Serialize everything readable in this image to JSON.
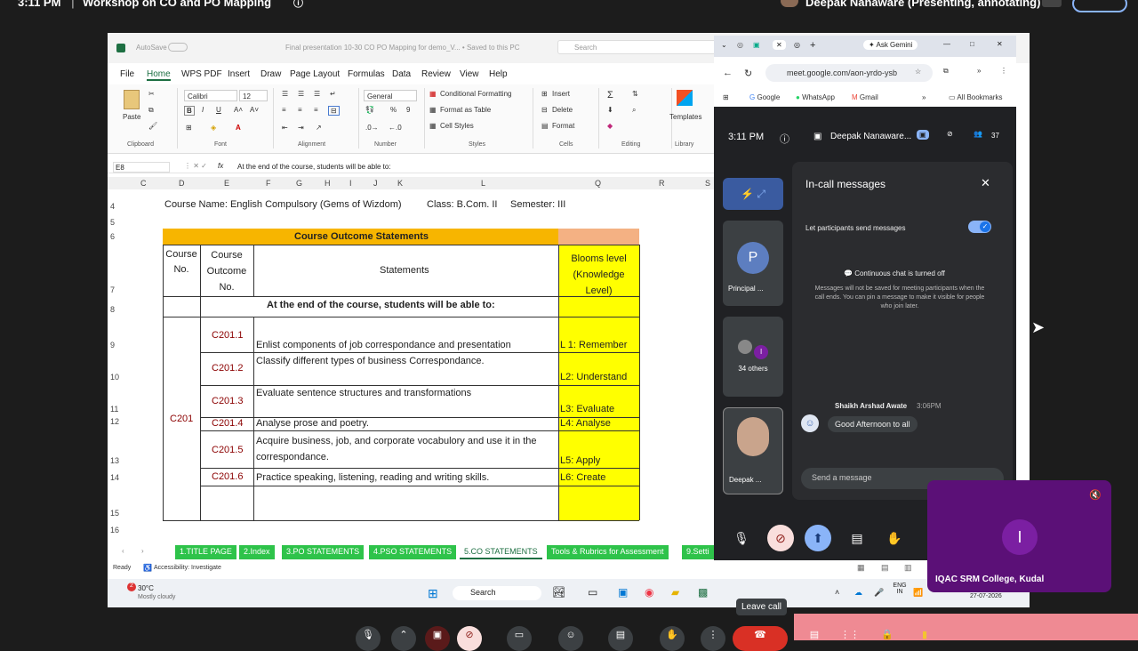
{
  "meet_top": {
    "time": "3:11 PM",
    "meeting_title": "Workshop on CO and PO Mapping",
    "presenter": "Deepak Nanaware (Presenting, annotating)"
  },
  "excel": {
    "autosave": "AutoSave",
    "file_title": "Final presentation 10-30 CO PO Mapping for demo_V... • Saved to this PC",
    "search": "Search",
    "menu": [
      "File",
      "Home",
      "WPS PDF",
      "Insert",
      "Draw",
      "Page Layout",
      "Formulas",
      "Data",
      "Review",
      "View",
      "Help"
    ],
    "ribbon": {
      "paste": "Paste",
      "font_name": "Calibri",
      "font_size": "12",
      "number_format": "General",
      "conditional": "Conditional Formatting",
      "format_table": "Format as Table",
      "cell_styles": "Cell Styles",
      "insert": "Insert",
      "delete": "Delete",
      "format": "Format",
      "templates": "Templates",
      "groups": [
        "Clipboard",
        "Font",
        "Alignment",
        "Number",
        "Styles",
        "Cells",
        "Editing",
        "Library"
      ]
    },
    "name_box": "E8",
    "formula": "At the end of the course, students will be able to:",
    "columns": [
      "C",
      "D",
      "E",
      "F",
      "G",
      "H",
      "I",
      "J",
      "K",
      "L",
      "Q",
      "R",
      "S"
    ],
    "rows": [
      "4",
      "5",
      "6",
      "7",
      "8",
      "9",
      "10",
      "11",
      "12",
      "13",
      "14",
      "15",
      "16"
    ],
    "course_name": "Course Name: English Compulsory (Gems of Wizdom)",
    "class": "Class: B.Com. II",
    "semester": "Semester: III",
    "table_title": "Course Outcome Statements",
    "hdr_course_no": "Course No.",
    "hdr_outcome_no": "Course Outcome No.",
    "hdr_statements": "Statements",
    "hdr_blooms": "Blooms level (Knowledge Level)",
    "intro": "At the end of the course, students will be able to:",
    "course_code": "C201",
    "outcomes": [
      {
        "code": "C201.1",
        "text": "Enlist components of  job correspondance and presentation",
        "level": "L 1: Remember"
      },
      {
        "code": "C201.2",
        "text": "Classify different types of business Correspondance.",
        "level": "L2: Understand"
      },
      {
        "code": "C201.3",
        "text": "Evaluate sentence structures and transformations",
        "level": "L3: Evaluate"
      },
      {
        "code": "C201.4",
        "text": "Analyse prose and poetry.",
        "level": "L4: Analyse"
      },
      {
        "code": "C201.5",
        "text": "Acquire business, job, and corporate vocabulory and use it in the correspondance.",
        "level": "L5: Apply"
      },
      {
        "code": "C201.6",
        "text": "Practice speaking, listening, reading and writing skills.",
        "level": "L6: Create"
      }
    ],
    "sheet_tabs": [
      "1.TITLE PAGE",
      "2.Index",
      "3.PO STATEMENTS",
      "4.PSO STATEMENTS",
      "5.CO STATEMENTS",
      "Tools & Rubrics for Assessment",
      "9.Setti"
    ],
    "status_ready": "Ready",
    "accessibility": "Accessibility: Investigate",
    "weather_temp": "30°C",
    "weather_desc": "Mostly cloudy",
    "taskbar_search": "Search",
    "tray_lang": "ENG IN",
    "tray_date": "27-07-2026"
  },
  "browser": {
    "ask_gemini": "Ask Gemini",
    "url": "meet.google.com/aon-yrdo-ysb",
    "bookmarks": [
      "Google",
      "WhatsApp",
      "Gmail"
    ],
    "all_bookmarks": "All Bookmarks",
    "meet_time": "3:11 PM",
    "presenter_chip": "Deepak Nanaware...",
    "participants_count": "37",
    "panel_title": "In-call messages",
    "toggle_label": "Let participants send messages",
    "chat_off_title": "Continuous chat is turned off",
    "chat_off_desc": "Messages will not be saved for meeting participants when the call ends. You can pin a message to make it visible for people who join later.",
    "msg_sender": "Shaikh Arshad Awate",
    "msg_time": "3:06PM",
    "msg_text": "Good Afternoon to all",
    "send_placeholder": "Send a message",
    "tile_principal_initial": "P",
    "tile_principal": "Principal ...",
    "tile_others": "34 others",
    "tile_others_initial": "I",
    "tile_deepak": "Deepak ..."
  },
  "iqac": {
    "initial": "I",
    "name": "IQAC SRM College, Kudal"
  },
  "leave_call_tooltip": "Leave call",
  "colors": {
    "table_title_bg": "#f7b500",
    "blooms_bg": "#ffff00",
    "sheet_tab_green": "#2ec34a",
    "iqac_bg": "#5b1077",
    "code_red": "#8b0000",
    "meet_dark": "#202124"
  }
}
